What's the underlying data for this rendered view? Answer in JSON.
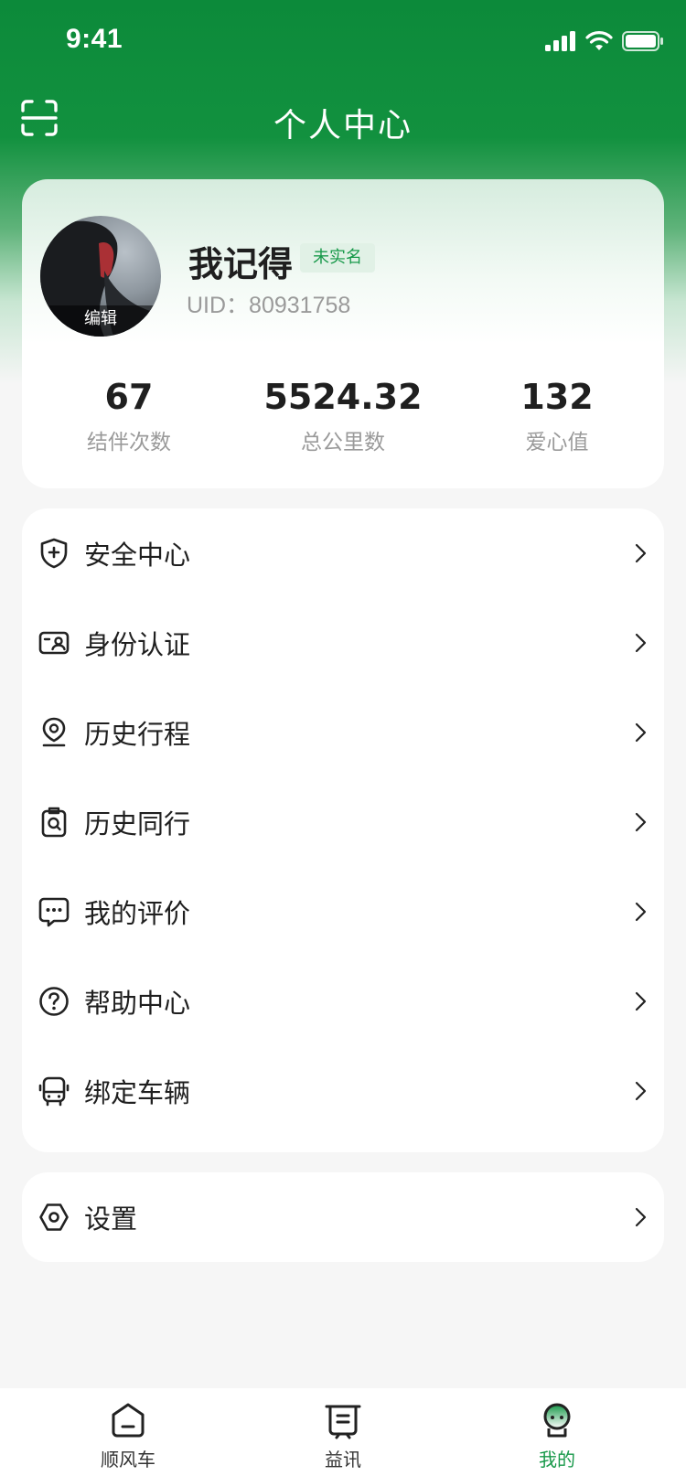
{
  "status": {
    "time": "9:41"
  },
  "header": {
    "title": "个人中心"
  },
  "profile": {
    "avatar_edit": "编辑",
    "username": "我记得",
    "realname_badge": "未实名",
    "uid": "UID：80931758"
  },
  "stats": [
    {
      "value": "67",
      "label": "结伴次数"
    },
    {
      "value": "5524.32",
      "label": "总公里数"
    },
    {
      "value": "132",
      "label": "爱心值"
    }
  ],
  "menu": [
    {
      "label": "安全中心",
      "icon": "shield-plus-icon"
    },
    {
      "label": "身份认证",
      "icon": "id-card-icon"
    },
    {
      "label": "历史行程",
      "icon": "location-pin-icon"
    },
    {
      "label": "历史同行",
      "icon": "badge-search-icon"
    },
    {
      "label": "我的评价",
      "icon": "chat-bubble-icon"
    },
    {
      "label": "帮助中心",
      "icon": "help-circle-icon"
    },
    {
      "label": "绑定车辆",
      "icon": "bus-icon"
    }
  ],
  "settings": {
    "label": "设置",
    "icon": "hexagon-settings-icon"
  },
  "tabs": [
    {
      "label": "顺风车",
      "icon": "home-icon"
    },
    {
      "label": "益讯",
      "icon": "news-icon"
    },
    {
      "label": "我的",
      "icon": "profile-icon"
    }
  ],
  "colors": {
    "brand": "#12913f",
    "accent": "#18994a",
    "badge_bg": "#e1f1e6"
  }
}
